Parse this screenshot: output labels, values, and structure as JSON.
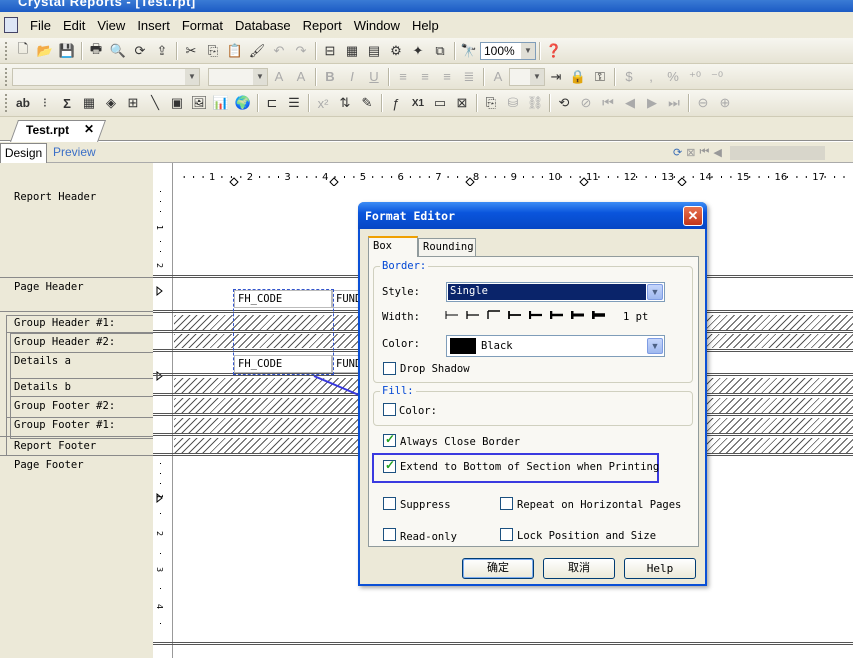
{
  "window": {
    "title": "Crystal Reports - [Test.rpt]"
  },
  "menu": [
    "File",
    "Edit",
    "View",
    "Insert",
    "Format",
    "Database",
    "Report",
    "Window",
    "Help"
  ],
  "toolbar": {
    "zoom": "100%"
  },
  "doc_tab": {
    "label": "Test.rpt",
    "close": "✕"
  },
  "view_tabs": {
    "design": "Design",
    "preview": "Preview"
  },
  "ruler": {
    "h_numbers": [
      "1",
      "2",
      "3",
      "4",
      "5",
      "6",
      "7",
      "8",
      "9",
      "10",
      "11",
      "12",
      "13",
      "14",
      "15",
      "16",
      "17"
    ],
    "v_labels": [
      "1",
      "2",
      "1",
      "2",
      "3",
      "4"
    ]
  },
  "sections": [
    "Report Header",
    "Page Header",
    "Group Header #1:",
    "Group Header #2:",
    "Details a",
    "Details b",
    "Group Footer #2:",
    "Group Footer #1:",
    "Report Footer",
    "Page Footer"
  ],
  "fields": {
    "ph_code": "FH_CODE",
    "ph_fund": "FUND",
    "da_code": "FH_CODE",
    "da_fund": "FUND"
  },
  "dialog": {
    "title": "Format Editor",
    "close": "✕",
    "tabs": [
      "Box",
      "Rounding"
    ],
    "border_label": "Border:",
    "style_label": "Style:",
    "style_value": "Single",
    "width_label": "Width:",
    "width_value": "1 pt",
    "color_label": "Color:",
    "color_value": "Black",
    "drop_shadow": "Drop Shadow",
    "fill_label": "Fill:",
    "fill_color": "Color:",
    "always_close": "Always Close Border",
    "extend": "Extend to Bottom of Section when Printing",
    "suppress": "Suppress",
    "repeat": "Repeat on Horizontal Pages",
    "readonly": "Read-only",
    "lock": "Lock Position and Size",
    "ok": "确定",
    "cancel": "取消",
    "help": "Help"
  },
  "colors": {
    "accent": "#0b50d6",
    "highlight_box": "#3a3ae0",
    "selection": "#0a246a"
  }
}
